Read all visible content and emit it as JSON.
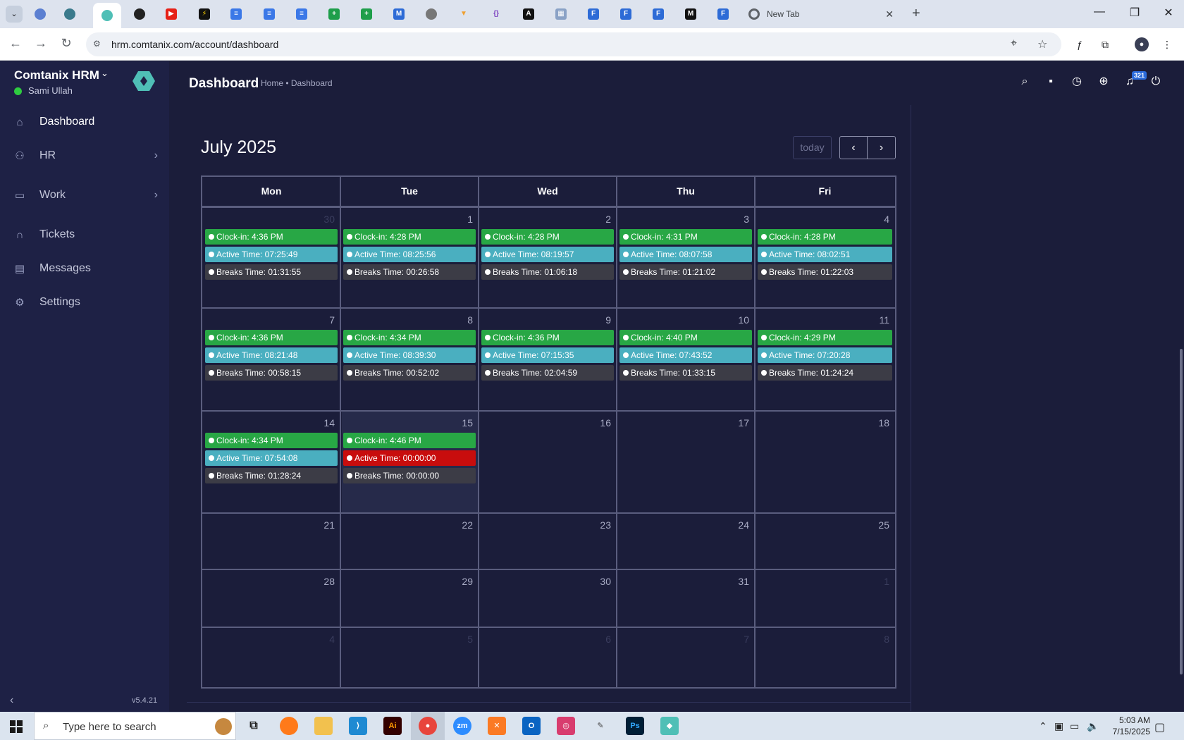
{
  "browser": {
    "active_tab_title": "New Tab",
    "url": "hrm.comtanix.com/account/dashboard"
  },
  "app": {
    "brand": "Comtanix HRM",
    "user": "Sami Ullah",
    "version": "v5.4.21",
    "nav": [
      {
        "label": "Dashboard",
        "icon": "home-icon"
      },
      {
        "label": "HR",
        "icon": "users-icon"
      },
      {
        "label": "Work",
        "icon": "briefcase-icon"
      },
      {
        "label": "Tickets",
        "icon": "headset-icon"
      },
      {
        "label": "Messages",
        "icon": "message-icon"
      },
      {
        "label": "Settings",
        "icon": "gear-icon"
      }
    ],
    "page_title": "Dashboard",
    "breadcrumb": "Home • Dashboard",
    "notifications_count": "321"
  },
  "calendar": {
    "title": "July 2025",
    "today_label": "today",
    "weekdays": [
      "Mon",
      "Tue",
      "Wed",
      "Thu",
      "Fri"
    ],
    "weeks": [
      [
        {
          "d": "30",
          "o": true,
          "ci": "Clock-in: 4:36 PM",
          "at": "Active Time: 07:25:49",
          "bt": "Breaks Time: 01:31:55"
        },
        {
          "d": "1",
          "ci": "Clock-in: 4:28 PM",
          "at": "Active Time: 08:25:56",
          "bt": "Breaks Time: 00:26:58"
        },
        {
          "d": "2",
          "ci": "Clock-in: 4:28 PM",
          "at": "Active Time: 08:19:57",
          "bt": "Breaks Time: 01:06:18"
        },
        {
          "d": "3",
          "ci": "Clock-in: 4:31 PM",
          "at": "Active Time: 08:07:58",
          "bt": "Breaks Time: 01:21:02"
        },
        {
          "d": "4",
          "ci": "Clock-in: 4:28 PM",
          "at": "Active Time: 08:02:51",
          "bt": "Breaks Time: 01:22:03"
        }
      ],
      [
        {
          "d": "7",
          "ci": "Clock-in: 4:36 PM",
          "at": "Active Time: 08:21:48",
          "bt": "Breaks Time: 00:58:15"
        },
        {
          "d": "8",
          "ci": "Clock-in: 4:34 PM",
          "at": "Active Time: 08:39:30",
          "bt": "Breaks Time: 00:52:02"
        },
        {
          "d": "9",
          "ci": "Clock-in: 4:36 PM",
          "at": "Active Time: 07:15:35",
          "bt": "Breaks Time: 02:04:59"
        },
        {
          "d": "10",
          "ci": "Clock-in: 4:40 PM",
          "at": "Active Time: 07:43:52",
          "bt": "Breaks Time: 01:33:15"
        },
        {
          "d": "11",
          "ci": "Clock-in: 4:29 PM",
          "at": "Active Time: 07:20:28",
          "bt": "Breaks Time: 01:24:24"
        }
      ],
      [
        {
          "d": "14",
          "ci": "Clock-in: 4:34 PM",
          "at": "Active Time: 07:54:08",
          "bt": "Breaks Time: 01:28:24"
        },
        {
          "d": "15",
          "today": true,
          "ci": "Clock-in: 4:46 PM",
          "at": "Active Time: 00:00:00",
          "bt": "Breaks Time: 00:00:00",
          "at_alert": true
        },
        {
          "d": "16"
        },
        {
          "d": "17"
        },
        {
          "d": "18"
        }
      ],
      [
        {
          "d": "21"
        },
        {
          "d": "22"
        },
        {
          "d": "23"
        },
        {
          "d": "24"
        },
        {
          "d": "25"
        }
      ],
      [
        {
          "d": "28"
        },
        {
          "d": "29"
        },
        {
          "d": "30"
        },
        {
          "d": "31"
        },
        {
          "d": "1",
          "o": true
        }
      ],
      [
        {
          "d": "4",
          "o": true
        },
        {
          "d": "5",
          "o": true
        },
        {
          "d": "6",
          "o": true
        },
        {
          "d": "7",
          "o": true
        },
        {
          "d": "8",
          "o": true
        }
      ]
    ],
    "colors": {
      "clock_in": "#28a745",
      "active": "#4aafc0",
      "breaks": "#3c3c46",
      "alert": "#c80d0d"
    }
  },
  "taskbar": {
    "search_placeholder": "Type here to search",
    "time": "5:03 AM",
    "date": "7/15/2025"
  }
}
